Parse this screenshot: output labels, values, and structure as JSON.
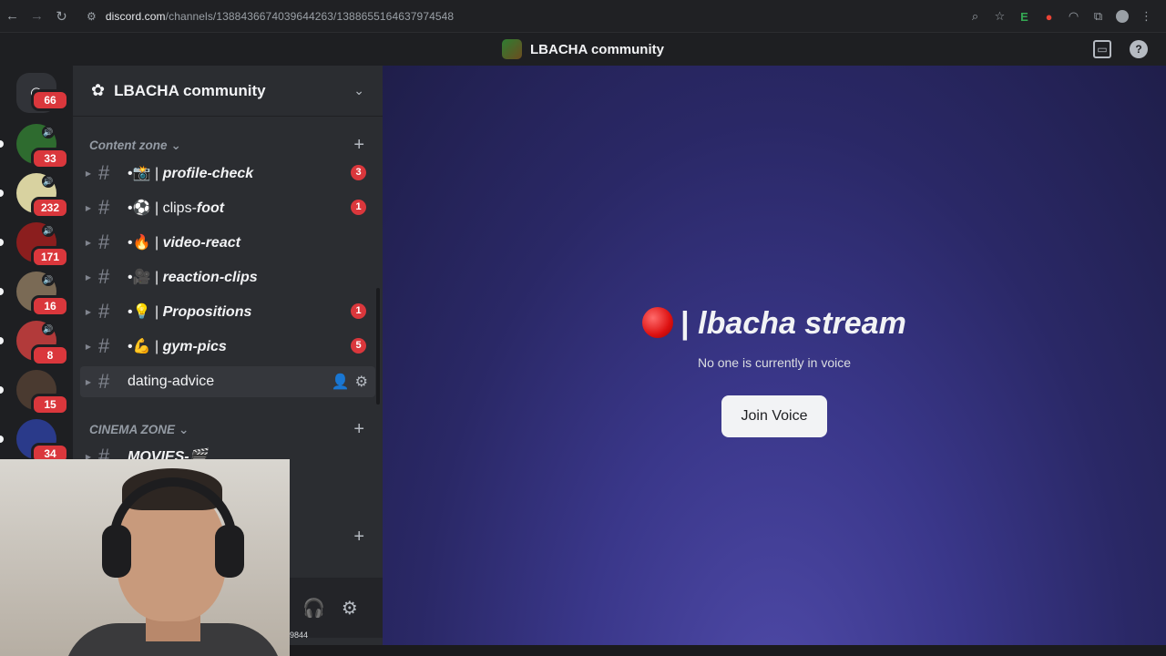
{
  "browser": {
    "url_domain": "discord.com",
    "url_path": "/channels/1388436674039644263/1388655164637974548",
    "icons": [
      "back-icon",
      "forward-icon",
      "reload-icon",
      "site-settings-icon",
      "zoom-icon",
      "bookmark-star-icon",
      "extension-e-icon",
      "extension-shield-icon",
      "extension-arc-icon",
      "extensions-puzzle-icon",
      "profile-icon",
      "menu-dots-icon"
    ]
  },
  "titlebar": {
    "server_name": "LBACHA community"
  },
  "rail": {
    "home_badge": "66",
    "servers": [
      {
        "badge": "33",
        "color": "#2e6b2f"
      },
      {
        "badge": "232",
        "color": "#d8d2a0"
      },
      {
        "badge": "171",
        "color": "#8b1e1e"
      },
      {
        "badge": "16",
        "color": "#7a6a55"
      },
      {
        "badge": "8",
        "color": "#b23a3a"
      },
      {
        "badge": "15",
        "color": "#4a3a30"
      },
      {
        "badge": "34",
        "color": "#2a3a8a"
      }
    ]
  },
  "sidebar": {
    "server_name": "LBACHA community",
    "categories": [
      {
        "label": "Content zone",
        "caret": "⌄",
        "plus": "+"
      },
      {
        "label": "CINEMA ZONE",
        "caret": "⌄",
        "plus": "+"
      }
    ],
    "channels": [
      {
        "prefix": "•📸 | ",
        "name": "profile-check",
        "badge": "3"
      },
      {
        "prefix": "•⚽ | clips-",
        "name": "foot",
        "badge": "1"
      },
      {
        "prefix": "•🔥 | ",
        "name": "video-react",
        "badge": ""
      },
      {
        "prefix": "•🎥 | ",
        "name": "reaction-clips",
        "badge": ""
      },
      {
        "prefix": "•💡 | ",
        "name": "Propositions",
        "badge": "1"
      },
      {
        "prefix": "•💪 | ",
        "name": "gym-pics",
        "badge": "5"
      }
    ],
    "hovered_channel": "dating-advice",
    "cinema_channel": "MOVIES-🎬",
    "extra_plus": "+"
  },
  "user_panel": {
    "code": "9844"
  },
  "voice": {
    "channel_prefix": "| ",
    "channel_name": "lbacha stream",
    "status": "No one is currently in voice",
    "join_label": "Join Voice"
  }
}
